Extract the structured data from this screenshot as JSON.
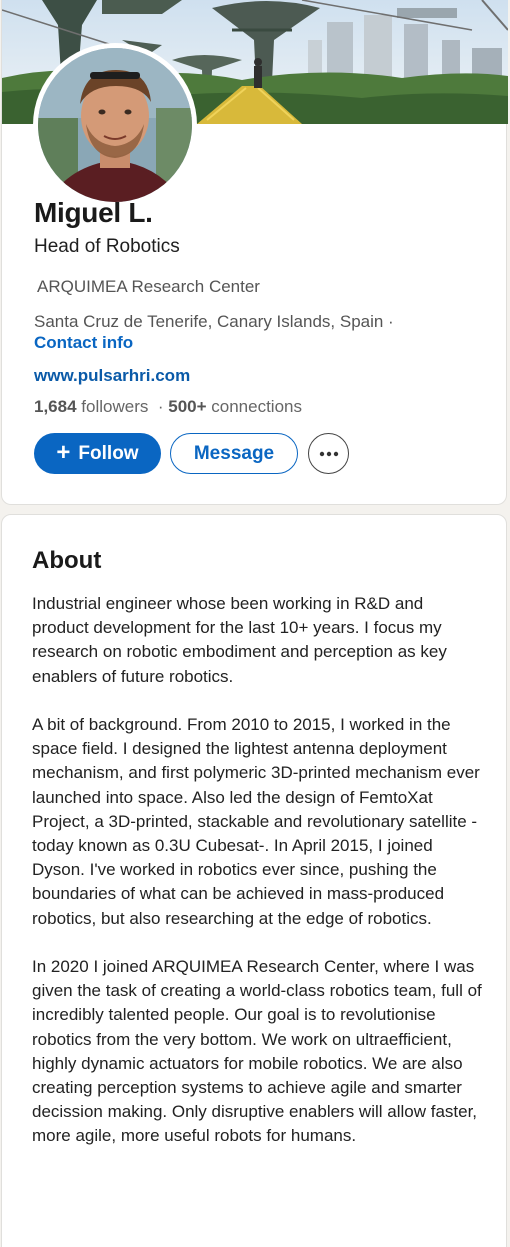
{
  "profile": {
    "name": "Miguel L.",
    "headline": "Head of Robotics",
    "company": "ARQUIMEA Research Center",
    "location": "Santa Cruz de Tenerife, Canary Islands, Spain ·",
    "contact_info_label": "Contact info",
    "website": "www.pulsarhri.com",
    "followers_count": "1,684",
    "followers_label": "followers",
    "connections_sep": "·",
    "connections_count": "500+",
    "connections_label": "connections"
  },
  "actions": {
    "follow_icon": "+",
    "follow_label": "Follow",
    "message_label": "Message",
    "more_icon": "more-horizontal-icon"
  },
  "about": {
    "title": "About",
    "paragraphs": [
      "Industrial engineer whose been working in R&D and product development for the last 10+ years. I focus my research on robotic embodiment and perception as key enablers of future robotics.",
      "A bit of background. From 2010 to 2015, I worked in the space field. I designed the lightest antenna deployment mechanism, and first polymeric 3D-printed mechanism ever launched into space. Also led the design of FemtoXat Project, a 3D-printed, stackable and revolutionary satellite -today known as 0.3U Cubesat-. In April 2015, I joined Dyson. I've worked in robotics ever since, pushing the boundaries of what can be achieved in mass-produced robotics, but also researching at the edge of robotics.",
      "In 2020 I joined ARQUIMEA Research Center, where I was given the task of creating a world-class robotics team, full of incredibly talented people. Our goal is to revolutionise robotics from the very bottom. We work on ultraefficient, highly dynamic actuators for mobile robotics. We are also creating perception systems to achieve agile and smarter decission making. Only disruptive enablers will allow faster, more agile, more useful robots for humans."
    ]
  },
  "colors": {
    "accent": "#0a66c2",
    "background": "#f4f2ee",
    "card": "#ffffff"
  }
}
